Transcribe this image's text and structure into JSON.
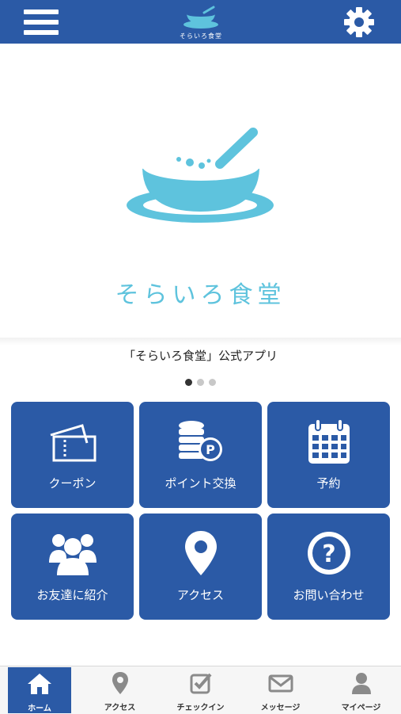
{
  "header": {
    "logo_text": "そらいろ食堂",
    "menu_icon": "hamburger-menu-icon",
    "settings_icon": "gear-icon"
  },
  "hero": {
    "logo_text": "そらいろ食堂",
    "caption": "「そらいろ食堂」公式アプリ",
    "slides_total": 3,
    "slide_active": 1
  },
  "tiles": [
    {
      "label": "クーポン",
      "icon": "ticket-icon"
    },
    {
      "label": "ポイント交換",
      "icon": "coins-point-icon"
    },
    {
      "label": "予約",
      "icon": "calendar-icon"
    },
    {
      "label": "お友達に紹介",
      "icon": "friends-icon"
    },
    {
      "label": "アクセス",
      "icon": "map-pin-icon"
    },
    {
      "label": "お問い合わせ",
      "icon": "question-icon"
    }
  ],
  "tabbar": [
    {
      "label": "ホーム",
      "icon": "home-icon",
      "active": true
    },
    {
      "label": "アクセス",
      "icon": "map-pin-icon"
    },
    {
      "label": "チェックイン",
      "icon": "checkin-icon"
    },
    {
      "label": "メッセージ",
      "icon": "envelope-icon"
    },
    {
      "label": "マイページ",
      "icon": "person-icon"
    }
  ],
  "colors": {
    "brand_blue": "#2b5aa6",
    "logo_cyan": "#5ec3dd"
  }
}
